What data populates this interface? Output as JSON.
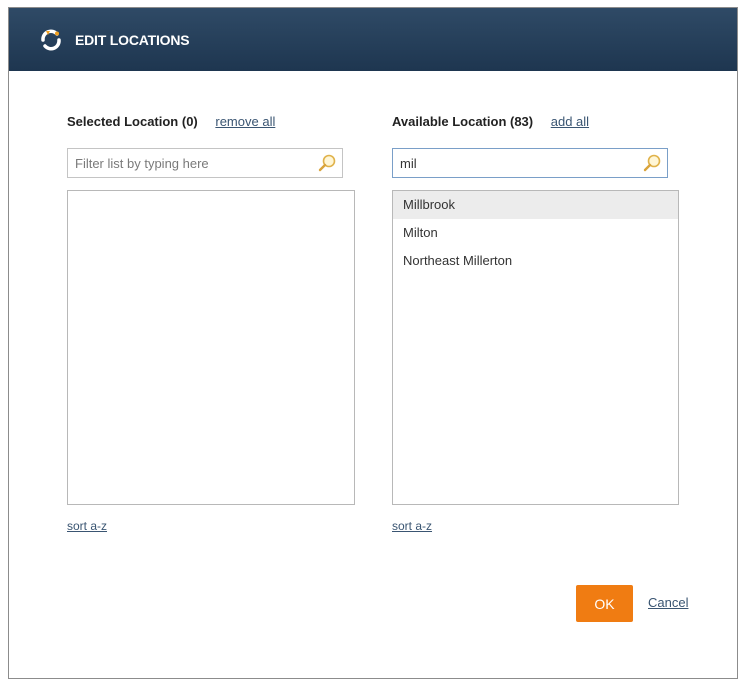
{
  "dialog": {
    "title": "EDIT LOCATIONS",
    "brand_color": "#233d58",
    "accent_color": "#f07c12"
  },
  "selected": {
    "header": "Selected Location (0)",
    "action_label": "remove all",
    "filter_placeholder": "Filter list by typing here",
    "filter_value": "",
    "items": [],
    "sort_label": "sort a-z"
  },
  "available": {
    "header": "Available Location (83)",
    "action_label": "add all",
    "filter_placeholder": "Filter list by typing here",
    "filter_value": "mil",
    "items": [
      "Millbrook",
      "Milton",
      "Northeast Millerton"
    ],
    "sort_label": "sort a-z"
  },
  "footer": {
    "ok_label": "OK",
    "cancel_label": "Cancel"
  }
}
